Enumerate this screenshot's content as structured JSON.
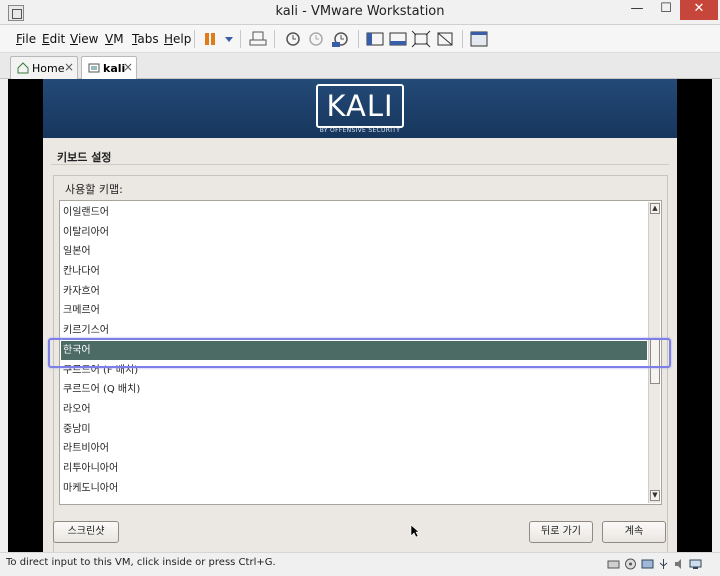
{
  "window": {
    "title": "kali - VMware Workstation"
  },
  "menu": [
    "File",
    "Edit",
    "View",
    "VM",
    "Tabs",
    "Help"
  ],
  "tabs": [
    {
      "label": "Home",
      "close": "×"
    },
    {
      "label": "kali",
      "close": "×"
    }
  ],
  "installer": {
    "logo_text": "KALI",
    "logo_subtext": "BY OFFENSIVE SECURITY",
    "section_title": "키보드 설정",
    "group_label": "사용할 키맵:",
    "keymaps": [
      "이일랜드어",
      "이탈리아어",
      "일본어",
      "칸나다어",
      "카자흐어",
      "크메르어",
      "키르기스어",
      "한국어",
      "쿠르드어 (F 배치)",
      "쿠르드어 (Q 배치)",
      "라오어",
      "중남미",
      "라트비아어",
      "리투아니아어",
      "마케도니아어"
    ],
    "selected_keymap": "한국어",
    "buttons": {
      "screenshot": "스크린샷",
      "back": "뒤로 가기",
      "continue": "계속"
    }
  },
  "statusbar": {
    "text": "To direct input to this VM, click inside or press Ctrl+G."
  },
  "colors": {
    "banner": "#1c3f68",
    "selection": "#4b6b64",
    "highlight_frame": "#7c7fe6",
    "close_button": "#c7463b"
  }
}
